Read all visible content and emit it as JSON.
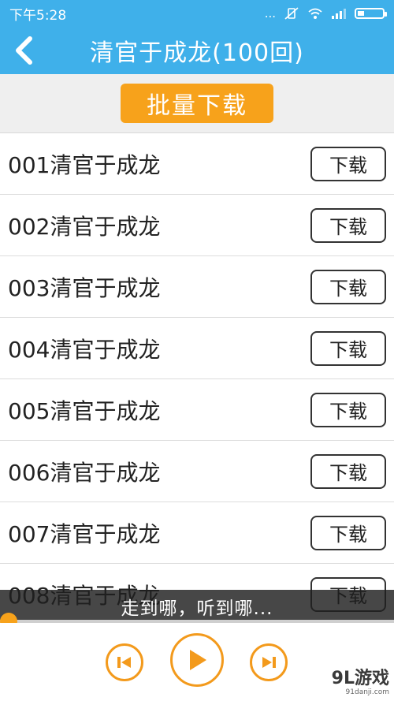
{
  "status_bar": {
    "time": "下午5:28",
    "dots": "...",
    "battery_level": 0.28
  },
  "header": {
    "title": "清官于成龙(100回)",
    "back_icon": "chevron-left-icon"
  },
  "batch_download": {
    "label": "批量下载"
  },
  "episodes": [
    {
      "title": "001清官于成龙",
      "button": "下载"
    },
    {
      "title": "002清官于成龙",
      "button": "下载"
    },
    {
      "title": "003清官于成龙",
      "button": "下载"
    },
    {
      "title": "004清官于成龙",
      "button": "下载"
    },
    {
      "title": "005清官于成龙",
      "button": "下载"
    },
    {
      "title": "006清官于成龙",
      "button": "下载"
    },
    {
      "title": "007清官于成龙",
      "button": "下载"
    },
    {
      "title": "008清官于成龙",
      "button": "下载"
    }
  ],
  "caption": "走到哪，听到哪...",
  "player": {
    "progress": 0.0,
    "accent": "#f39a1c"
  },
  "watermark": {
    "brand": "9L游戏",
    "url": "91danji.com"
  },
  "colors": {
    "header_bg": "#3fb0ea",
    "batch_button": "#f7a21b"
  }
}
